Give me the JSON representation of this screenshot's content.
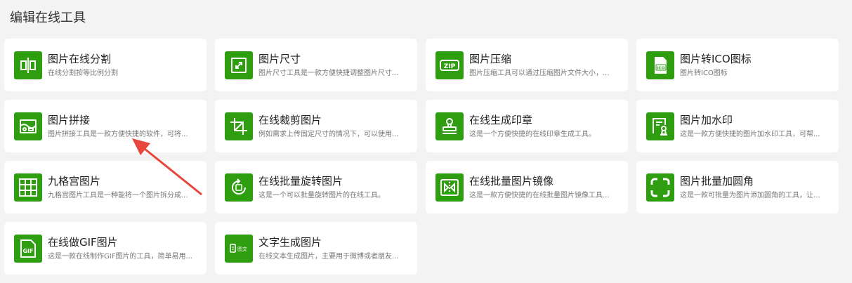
{
  "section_title": "编辑在线工具",
  "accent": "#2e9e10",
  "annotation_color": "#e8453c",
  "tools": [
    {
      "name": "图片在线分割",
      "desc": "在线分割按等比例分割",
      "icon": "split-icon"
    },
    {
      "name": "图片尺寸",
      "desc": "图片尺寸工具是一款方便快捷调整图片尺寸...",
      "icon": "resize-icon"
    },
    {
      "name": "图片压缩",
      "desc": "图片压缩工具可以通过压缩图片文件大小，...",
      "icon": "zip-icon",
      "icon_text": "ZIP"
    },
    {
      "name": "图片转ICO图标",
      "desc": "图片转ICO图标",
      "icon": "ico-file-icon",
      "icon_text": "ICO"
    },
    {
      "name": "图片拼接",
      "desc": "图片拼接工具是一款方便快捷的软件，可将...",
      "icon": "image-collage-icon"
    },
    {
      "name": "在线裁剪图片",
      "desc": "例如需求上传固定尺寸的情况下，可以使用...",
      "icon": "crop-icon"
    },
    {
      "name": "在线生成印章",
      "desc": "这是一个方便快捷的在线印章生成工具。",
      "icon": "stamp-icon"
    },
    {
      "name": "图片加水印",
      "desc": "这是一款方便快捷的图片加水印工具，可帮...",
      "icon": "watermark-icon"
    },
    {
      "name": "九格宫图片",
      "desc": "九格宫图片工具是一种能将一个图片拆分成...",
      "icon": "grid-nine-icon"
    },
    {
      "name": "在线批量旋转图片",
      "desc": "这是一个可以批量旋转图片的在线工具。",
      "icon": "rotate-icon"
    },
    {
      "name": "在线批量图片镜像",
      "desc": "这是一款方便快捷的在线批量图片镜像工具...",
      "icon": "mirror-icon"
    },
    {
      "name": "图片批量加圆角",
      "desc": "这是一款可批量为图片添加圆角的工具，让...",
      "icon": "rounded-corner-icon"
    },
    {
      "name": "在线做GIF图片",
      "desc": "这是一款在线制作GIF图片的工具，简单易用...",
      "icon": "gif-icon",
      "icon_text": "GIF"
    },
    {
      "name": "文字生成图片",
      "desc": "在线文本生成图片，主要用于微博或者朋友...",
      "icon": "text-to-image-icon",
      "icon_text": "图文"
    }
  ]
}
